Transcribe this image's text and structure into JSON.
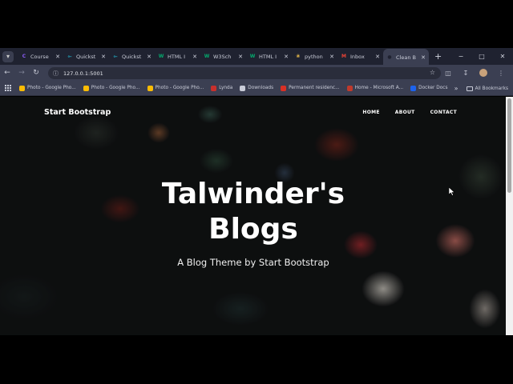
{
  "browser": {
    "tabs": [
      {
        "label": "Course",
        "favicon_color": "#8b5cf6",
        "favicon_glyph": "C"
      },
      {
        "label": "Quickst",
        "favicon_color": "#22a0b8",
        "favicon_glyph": "⟜"
      },
      {
        "label": "Quickst",
        "favicon_color": "#22a0b8",
        "favicon_glyph": "⟜"
      },
      {
        "label": "HTML I",
        "favicon_color": "#04aa6d",
        "favicon_glyph": "W"
      },
      {
        "label": "W3Sch",
        "favicon_color": "#04aa6d",
        "favicon_glyph": "W"
      },
      {
        "label": "HTML I",
        "favicon_color": "#04aa6d",
        "favicon_glyph": "W"
      },
      {
        "label": "python",
        "favicon_color": "#e8b94a",
        "favicon_glyph": "❀"
      },
      {
        "label": "Inbox",
        "favicon_color": "#ea4335",
        "favicon_glyph": "M"
      },
      {
        "label": "Clean B",
        "favicon_color": "#1f2230",
        "favicon_glyph": "●",
        "active": true
      }
    ],
    "new_tab_icon": "plus-icon",
    "window_controls": {
      "minimize": "−",
      "maximize": "□",
      "close": "✕"
    },
    "url": "127.0.0.1:5001",
    "bookmarks": [
      {
        "label": "Photo - Google Pho...",
        "icon_color": "#fbbc04"
      },
      {
        "label": "Photo - Google Pho...",
        "icon_color": "#fbbc04"
      },
      {
        "label": "Photo - Google Pho...",
        "icon_color": "#fbbc04"
      },
      {
        "label": "Lynda",
        "icon_color": "#c8302c"
      },
      {
        "label": "Downloads",
        "icon_color": "#c9ccd8"
      },
      {
        "label": "Permanent residenc...",
        "icon_color": "#d93025"
      },
      {
        "label": "Home - Microsoft A...",
        "icon_color": "#c0392b"
      },
      {
        "label": "Docker Docs",
        "icon_color": "#1d63ed"
      }
    ],
    "all_bookmarks_label": "All Bookmarks"
  },
  "page": {
    "brand": "Start Bootstrap",
    "nav": [
      "HOME",
      "ABOUT",
      "CONTACT"
    ],
    "hero_title_line1": "Talwinder's",
    "hero_title_line2": "Blogs",
    "hero_subtitle": "A Blog Theme by Start Bootstrap"
  }
}
